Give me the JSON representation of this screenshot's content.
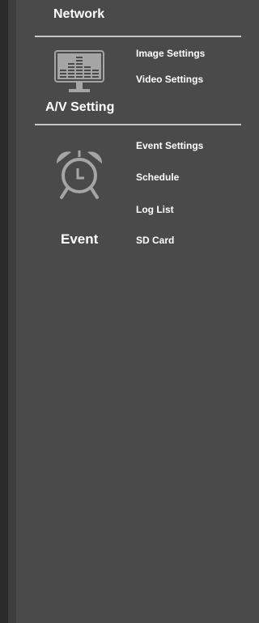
{
  "sections": {
    "network": {
      "title": "Network"
    },
    "av_setting": {
      "title": "A/V Setting",
      "icon": "equalizer-monitor-icon",
      "links": [
        "Image Settings",
        "Video Settings"
      ]
    },
    "event": {
      "title": "Event",
      "icon": "alarm-clock-icon",
      "links": [
        "Event Settings",
        "Schedule",
        "Log List",
        "SD Card"
      ]
    }
  },
  "colors": {
    "background": "#4a4a4a",
    "text": "#ffffff",
    "divider": "#c8c8c8",
    "icon": "#a5a5a5"
  }
}
